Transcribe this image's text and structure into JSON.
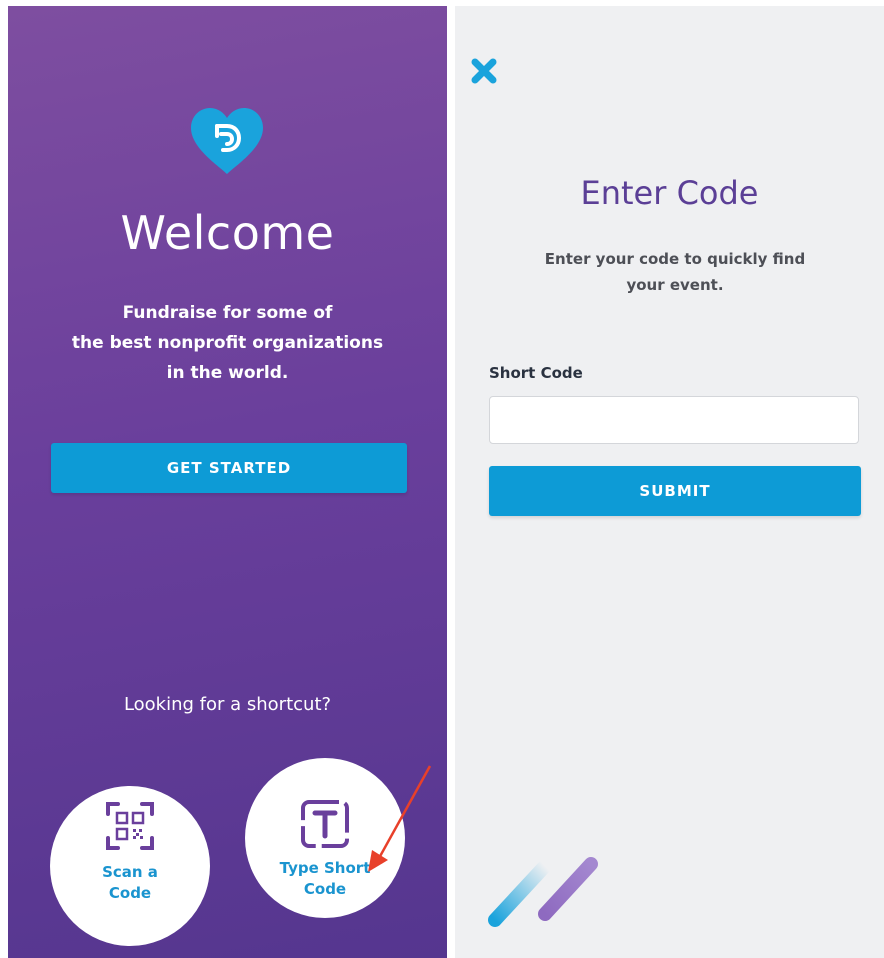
{
  "welcome_screen": {
    "title": "Welcome",
    "tagline": "Fundraise for some of\nthe best nonprofit organizations\nin the world.",
    "get_started_label": "GET STARTED",
    "shortcut_prompt": "Looking for a shortcut?",
    "scan_code_label": "Scan a\nCode",
    "type_short_code_label": "Type Short\nCode"
  },
  "enter_code_screen": {
    "title": "Enter Code",
    "description": "Enter your code to quickly find\nyour event.",
    "field_label": "Short Code",
    "field_value": "",
    "field_placeholder": "",
    "submit_label": "SUBMIT"
  },
  "colors": {
    "brand_purple": "#6a3f9c",
    "accent_blue": "#0d9bd6",
    "annotation_arrow": "#e8402a"
  },
  "icons": {
    "logo": "heart-logo-icon",
    "scan": "qr-code-icon",
    "type": "text-box-icon",
    "close": "close-icon"
  }
}
